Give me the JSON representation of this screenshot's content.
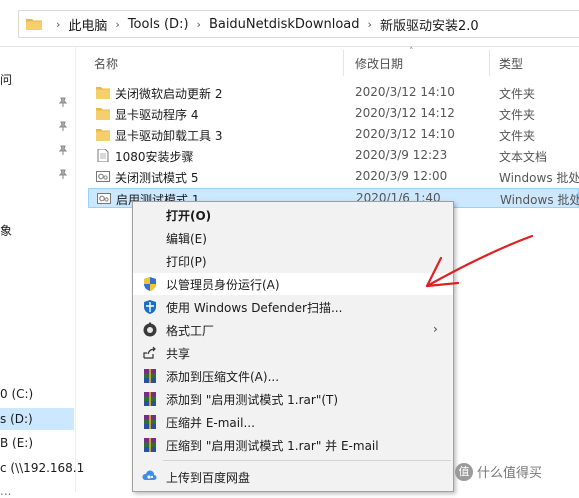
{
  "breadcrumb": {
    "items": [
      "此电脑",
      "Tools (D:)",
      "BaiduNetdiskDownload",
      "新版驱动安装2.0"
    ],
    "separator": "›"
  },
  "nav": {
    "items": [
      {
        "label": "问"
      },
      {
        "label": "象"
      },
      {
        "label": "0 (C:)"
      },
      {
        "label": "s (D:)",
        "selected": true
      },
      {
        "label": "B (E:)"
      },
      {
        "label": "c (\\\\192.168.1"
      },
      {
        "label": "..."
      }
    ]
  },
  "file_list": {
    "columns": {
      "name": "名称",
      "date": "修改日期",
      "type": "类型"
    },
    "rows": [
      {
        "name": "关闭微软启动更新 2",
        "date": "2020/3/12 14:10",
        "type": "文件夹",
        "icon": "folder-icon"
      },
      {
        "name": "显卡驱动程序 4",
        "date": "2020/3/12 14:12",
        "type": "文件夹",
        "icon": "folder-icon"
      },
      {
        "name": "显卡驱动卸载工具 3",
        "date": "2020/3/12 14:10",
        "type": "文件夹",
        "icon": "folder-icon"
      },
      {
        "name": "1080安装步骤",
        "date": "2020/3/9 12:23",
        "type": "文本文档",
        "icon": "text-file-icon"
      },
      {
        "name": "关闭测试模式 5",
        "date": "2020/3/9 12:00",
        "type": "Windows 批处",
        "icon": "batch-file-icon"
      },
      {
        "name": "启用测试模式 1",
        "date": "2020/1/6 1:40",
        "type": "Windows 批处",
        "icon": "batch-file-icon",
        "selected": true
      }
    ]
  },
  "context_menu": {
    "items": [
      {
        "label": "打开(O)",
        "bold": true,
        "icon": ""
      },
      {
        "label": "编辑(E)",
        "icon": ""
      },
      {
        "label": "打印(P)",
        "icon": ""
      },
      {
        "label": "以管理员身份运行(A)",
        "icon": "uac-shield-icon",
        "highlighted": true
      },
      {
        "label": "使用 Windows Defender扫描...",
        "icon": "defender-shield-icon"
      },
      {
        "label": "格式工厂",
        "icon": "format-factory-icon",
        "submenu": true
      },
      {
        "label": "共享",
        "icon": "share-icon"
      },
      {
        "label": "添加到压缩文件(A)...",
        "icon": "winrar-icon"
      },
      {
        "label": "添加到 \"启用测试模式 1.rar\"(T)",
        "icon": "winrar-icon"
      },
      {
        "label": "压缩并 E-mail...",
        "icon": "winrar-icon"
      },
      {
        "label": "压缩到 \"启用测试模式 1.rar\" 并 E-mail",
        "icon": "winrar-icon"
      },
      {
        "label": "上传到百度网盘",
        "icon": "baidu-netdisk-icon"
      }
    ]
  },
  "watermark": {
    "badge": "值",
    "text": "什么值得买"
  },
  "colors": {
    "selection_bg": "#cce8ff",
    "selection_border": "#99d1ff",
    "folder": "#e8b94a",
    "annotation": "#e02020",
    "menu_bg": "#f2f2f2"
  }
}
